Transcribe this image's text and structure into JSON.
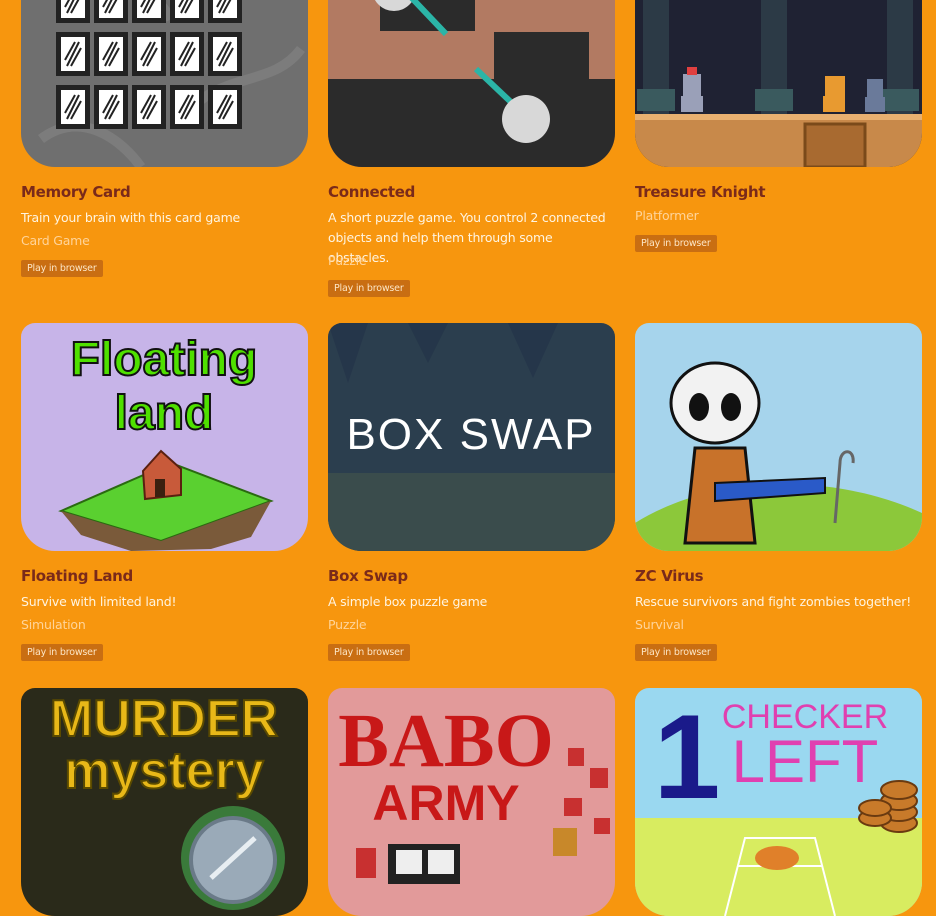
{
  "play_label": "Play in browser",
  "games": [
    {
      "title": "Memory Card",
      "description": "Train your brain with this card game",
      "genre": "Card Game"
    },
    {
      "title": "Connected",
      "description": "A short puzzle game. You control 2 connected objects and help them through some obstacles.",
      "genre": "Puzzle"
    },
    {
      "title": "Treasure Knight",
      "description": "",
      "genre": "Platformer"
    },
    {
      "title": "Floating Land",
      "description": "Survive with limited land!",
      "genre": "Simulation"
    },
    {
      "title": "Box Swap",
      "description": "A simple box puzzle game",
      "genre": "Puzzle"
    },
    {
      "title": "ZC Virus",
      "description": "Rescue survivors and fight zombies together!",
      "genre": "Survival"
    },
    {
      "title": "",
      "description": "",
      "genre": ""
    },
    {
      "title": "",
      "description": "",
      "genre": ""
    },
    {
      "title": "",
      "description": "",
      "genre": ""
    }
  ],
  "thumb_text": {
    "floating_land": [
      "Floating",
      "land"
    ],
    "box_swap": "BOX SWAP",
    "murder": [
      "MURDER",
      "mystery"
    ],
    "babo": [
      "BABO",
      "ARMY"
    ],
    "checker": [
      "1",
      "CHECKER",
      "LEFT"
    ]
  }
}
